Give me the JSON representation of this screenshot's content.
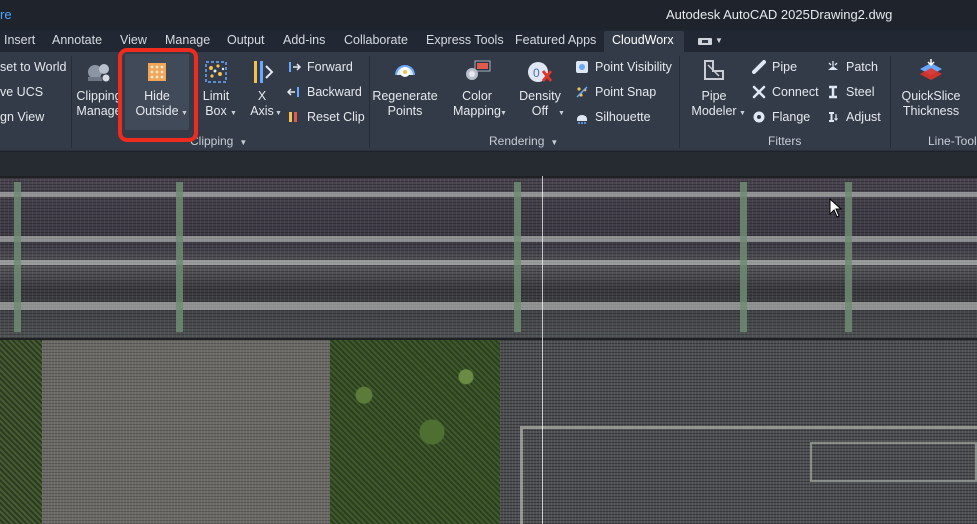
{
  "titlebar": {
    "left_fragment": "re",
    "app_title": "Autodesk AutoCAD 2025",
    "doc_title": "Drawing2.dwg"
  },
  "tabs": [
    {
      "label": "Insert"
    },
    {
      "label": "Annotate"
    },
    {
      "label": "View"
    },
    {
      "label": "Manage"
    },
    {
      "label": "Output"
    },
    {
      "label": "Add-ins"
    },
    {
      "label": "Collaborate"
    },
    {
      "label": "Express Tools"
    },
    {
      "label": "Featured Apps"
    },
    {
      "label": "CloudWorx",
      "active": true
    }
  ],
  "ucs_panel": {
    "items": [
      "set to World",
      "ve UCS",
      "gn View"
    ]
  },
  "clipping_panel": {
    "label": "Clipping",
    "clipping_manager": {
      "line1": "Clipping",
      "line2": "Manage"
    },
    "hide_outside": {
      "line1": "Hide",
      "line2": "Outside"
    },
    "limit_box": {
      "line1": "Limit",
      "line2": "Box"
    },
    "x_axis": {
      "line1": "X",
      "line2": "Axis"
    },
    "forward": "Forward",
    "backward": "Backward",
    "reset_clip": "Reset Clip"
  },
  "rendering_panel": {
    "label": "Rendering",
    "regenerate_points": {
      "line1": "Regenerate",
      "line2": "Points"
    },
    "color_mapping": {
      "line1": "Color",
      "line2": "Mapping"
    },
    "density_off": {
      "line1": "Density",
      "line2": "Off"
    },
    "point_visibility": "Point Visibility",
    "point_snap": "Point Snap",
    "silhouette": "Silhouette"
  },
  "fitters_panel": {
    "label": "Fitters",
    "pipe_modeler": {
      "line1": "Pipe",
      "line2": "Modeler"
    },
    "pipe": "Pipe",
    "connect": "Connect",
    "flange": "Flange",
    "patch": "Patch",
    "steel": "Steel",
    "adjust": "Adjust"
  },
  "linetools_panel": {
    "label": "Line-Tool",
    "quickslice": {
      "line1": "QuickSlice",
      "line2": "Thickness"
    }
  },
  "colors": {
    "highlight": "#ee2b1e",
    "accent_blue": "#4ea3ff",
    "ribbon_bg": "#333b48"
  }
}
